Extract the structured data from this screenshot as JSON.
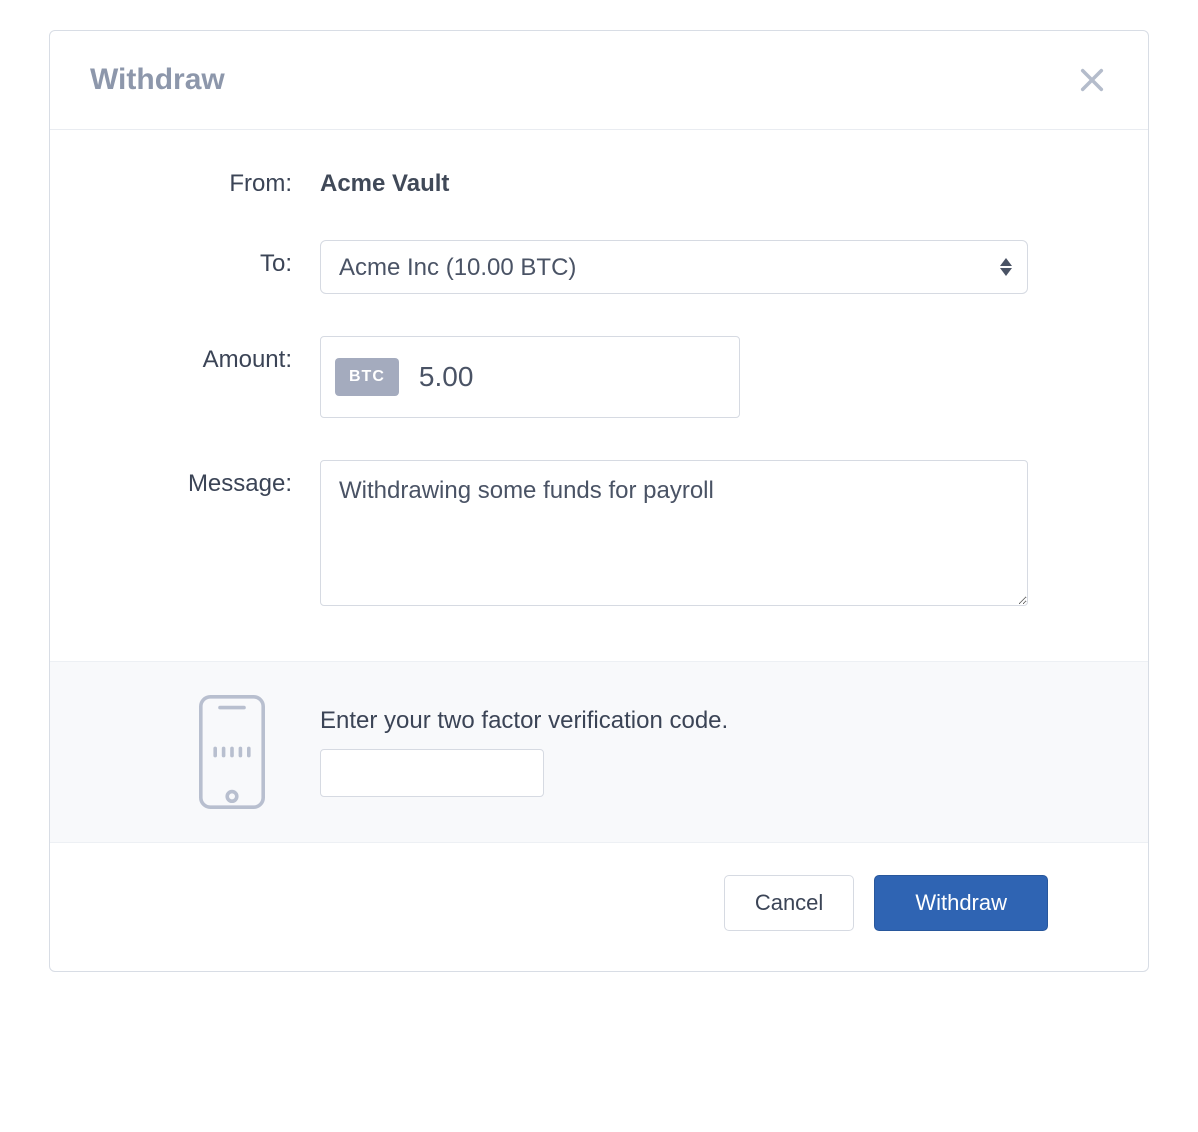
{
  "header": {
    "title": "Withdraw"
  },
  "form": {
    "from_label": "From:",
    "from_value": "Acme Vault",
    "to_label": "To:",
    "to_selected": "Acme Inc (10.00 BTC)",
    "amount_label": "Amount:",
    "amount_currency_badge": "BTC",
    "amount_value": "5.00",
    "message_label": "Message:",
    "message_value": "Withdrawing some funds for payroll"
  },
  "twofa": {
    "prompt": "Enter your two factor verification code.",
    "code_value": ""
  },
  "footer": {
    "cancel_label": "Cancel",
    "submit_label": "Withdraw"
  }
}
